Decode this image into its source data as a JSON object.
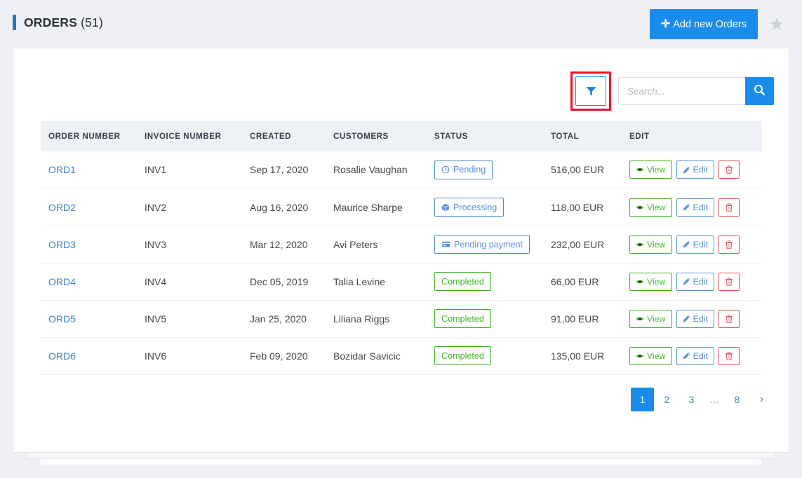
{
  "header": {
    "title": "ORDERS",
    "count": "(51)",
    "add_button": {
      "label": "Add new Orders",
      "icon": "plus-icon"
    },
    "favorite_icon": "star-icon",
    "accent_color": "#1b8ceb",
    "title_bar_color": "#3475b0"
  },
  "toolbar": {
    "filter_button": {
      "icon": "filter-icon",
      "highlighted": true,
      "highlight_color": "#fc0d1b"
    },
    "search": {
      "placeholder": "Search...",
      "value": ""
    },
    "search_button": {
      "icon": "search-icon"
    }
  },
  "table": {
    "columns": [
      "ORDER NUMBER",
      "INVOICE NUMBER",
      "CREATED",
      "CUSTOMERS",
      "STATUS",
      "TOTAL",
      "EDIT"
    ],
    "rows": [
      {
        "order_number": "ORD1",
        "invoice_number": "INV1",
        "created": "Sep 17, 2020",
        "customer": "Rosalie Vaughan",
        "status": {
          "label": "Pending",
          "icon": "clock-icon",
          "tone": "blue"
        },
        "total": "516,00 EUR"
      },
      {
        "order_number": "ORD2",
        "invoice_number": "INV2",
        "created": "Aug 16, 2020",
        "customer": "Maurice Sharpe",
        "status": {
          "label": "Processing",
          "icon": "box-icon",
          "tone": "blue"
        },
        "total": "118,00 EUR"
      },
      {
        "order_number": "ORD3",
        "invoice_number": "INV3",
        "created": "Mar 12, 2020",
        "customer": "Avi Peters",
        "status": {
          "label": "Pending payment",
          "icon": "credit-card-icon",
          "tone": "blue"
        },
        "total": "232,00 EUR"
      },
      {
        "order_number": "ORD4",
        "invoice_number": "INV4",
        "created": "Dec 05, 2019",
        "customer": "Talia Levine",
        "status": {
          "label": "Completed",
          "icon": "none",
          "tone": "green"
        },
        "total": "66,00 EUR"
      },
      {
        "order_number": "ORD5",
        "invoice_number": "INV5",
        "created": "Jan 25, 2020",
        "customer": "Liliana Riggs",
        "status": {
          "label": "Completed",
          "icon": "none",
          "tone": "green"
        },
        "total": "91,00 EUR"
      },
      {
        "order_number": "ORD6",
        "invoice_number": "INV6",
        "created": "Feb 09, 2020",
        "customer": "Bozidar Savicic",
        "status": {
          "label": "Completed",
          "icon": "none",
          "tone": "green"
        },
        "total": "135,00 EUR"
      }
    ],
    "actions": {
      "view_label": "View",
      "view_icon": "eye-icon",
      "edit_label": "Edit",
      "edit_icon": "pencil-icon",
      "delete_icon": "trash-icon"
    }
  },
  "pagination": {
    "items": [
      "1",
      "2",
      "3",
      "…",
      "8"
    ],
    "active": "1",
    "next_icon": "chevron-right-icon",
    "next_label": "›"
  }
}
